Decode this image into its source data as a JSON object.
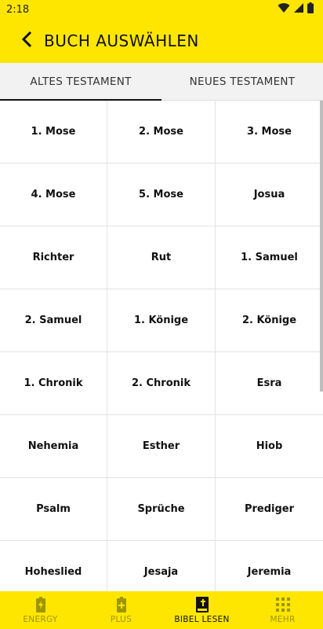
{
  "status": {
    "time": "2:18"
  },
  "header": {
    "title": "BUCH AUSWÄHLEN"
  },
  "tabs": [
    {
      "label": "ALTES TESTAMENT",
      "active": true
    },
    {
      "label": "NEUES TESTAMENT",
      "active": false
    }
  ],
  "books": [
    "1. Mose",
    "2. Mose",
    "3. Mose",
    "4. Mose",
    "5. Mose",
    "Josua",
    "Richter",
    "Rut",
    "1. Samuel",
    "2. Samuel",
    "1. Könige",
    "2. Könige",
    "1. Chronik",
    "2. Chronik",
    "Esra",
    "Nehemia",
    "Esther",
    "Hiob",
    "Psalm",
    "Sprüche",
    "Prediger",
    "Hoheslied",
    "Jesaja",
    "Jeremia"
  ],
  "nav": [
    {
      "label": "ENERGY",
      "icon": "battery-bolt-icon",
      "active": false
    },
    {
      "label": "PLUS",
      "icon": "battery-plus-icon",
      "active": false
    },
    {
      "label": "BIBEL LESEN",
      "icon": "bible-icon",
      "active": true
    },
    {
      "label": "MEHR",
      "icon": "grid-dots-icon",
      "active": false
    }
  ],
  "colors": {
    "accent": "#ffe600",
    "inactive_nav": "#9e9600"
  }
}
